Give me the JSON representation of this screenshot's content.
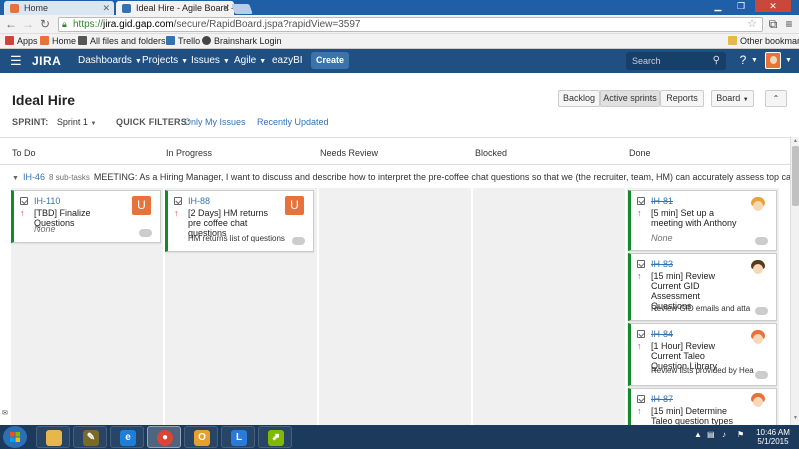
{
  "browser": {
    "tabs": [
      {
        "title": "Home",
        "active": false,
        "favicon_color": "#e8733a"
      },
      {
        "title": "Ideal Hire - Agile Board - ",
        "active": true,
        "favicon_color": "#3572b0"
      }
    ],
    "url_scheme": "https://",
    "url_host": "jira.gid.gap.com",
    "url_path": "/secure/RapidBoard.jspa?rapidView=3597",
    "bookmarks": [
      {
        "label": "Apps",
        "icon_color": "#d04437"
      },
      {
        "label": "Home",
        "icon_color": "#e8733a"
      },
      {
        "label": "All files and folders ...",
        "icon_color": "#555555"
      },
      {
        "label": "Trello",
        "icon_color": "#3572b0"
      },
      {
        "label": "Brainshark Login",
        "icon_color": "#444444"
      }
    ],
    "other_bookmarks": "Other bookmarks"
  },
  "jira": {
    "logo": "JIRA",
    "nav": [
      "Dashboards",
      "Projects",
      "Issues",
      "Agile",
      "eazyBI"
    ],
    "create_label": "Create",
    "search_placeholder": "Search",
    "help_icon": "help-icon"
  },
  "board": {
    "title": "Ideal Hire",
    "sprint_label": "SPRINT:",
    "sprint_value": "Sprint 1",
    "quick_filters_label": "QUICK FILTERS:",
    "quick_filters": [
      "Only My Issues",
      "Recently Updated"
    ],
    "view_buttons": [
      "Backlog",
      "Active sprints",
      "Reports"
    ],
    "selected_view": "Active sprints",
    "board_menu": "Board",
    "columns": [
      "To Do",
      "In Progress",
      "Needs Review",
      "Blocked",
      "Done"
    ],
    "swimlane": {
      "key": "IH-46",
      "subtasks": "8 sub-tasks",
      "summary": "MEETING: As a Hiring Manager, I want to discuss and describe how to interpret the pre-coffee chat questions so that we (the recruiter, team, HM) can accurately assess top candidat"
    },
    "cards": {
      "todo": [
        {
          "key": "IH-110",
          "summary": "[TBD] Finalize Questions",
          "extra": "None",
          "avatar": "U"
        }
      ],
      "in_progress": [
        {
          "key": "IH-88",
          "summary": "[2 Days] HM returns pre coffee chat questions",
          "extra": "HM returns list of questions",
          "avatar": "U"
        }
      ],
      "done": [
        {
          "key": "IH-81",
          "summary": "[5 min] Set up a meeting with Anthony",
          "extra": "None"
        },
        {
          "key": "IH-83",
          "summary": "[15 min] Review Current GID Assessment Questions",
          "extra": "Review GID emails and atta"
        },
        {
          "key": "IH-84",
          "summary": "[1 Hour] Review Current Taleo Question Library",
          "extra": "Review lists provided by Hea"
        },
        {
          "key": "IH-87",
          "summary": "[15 min] Determine Taleo question types",
          "extra": ""
        }
      ]
    }
  },
  "taskbar": {
    "time": "10:46 AM",
    "date": "5/1/2015"
  },
  "colors": {
    "jira_header": "#205081",
    "create_button": "#3b73af",
    "link": "#3572b0",
    "done_status": "#14892c",
    "priority_up": "#d04437",
    "avatar_orange": "#e8733a"
  }
}
